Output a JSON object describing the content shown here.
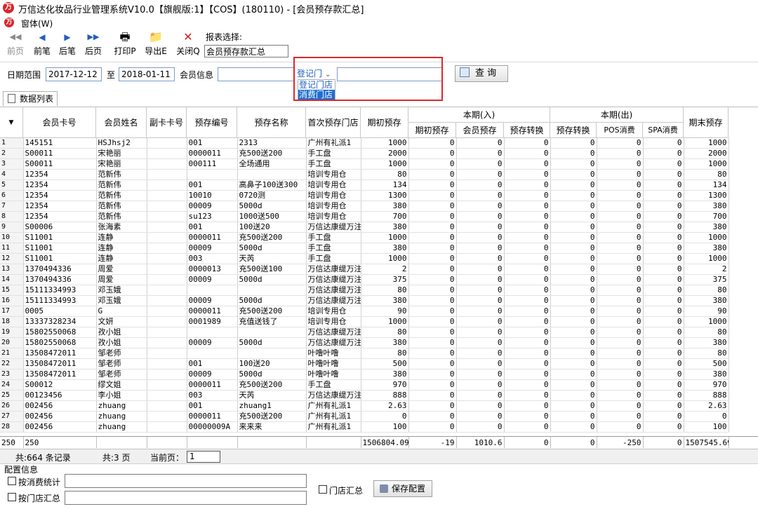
{
  "window": {
    "title": "万信达化妆品行业管理系统V10.0【旗舰版:1】【COS】(180110) - [会员预存款汇总]",
    "logo_text": "万"
  },
  "menu": {
    "item": "窗体(W)"
  },
  "toolbar": {
    "buttons": [
      {
        "label": "前页",
        "icon": "◀◀",
        "disabled": true
      },
      {
        "label": "前笔",
        "icon": "◀",
        "disabled": false
      },
      {
        "label": "后笔",
        "icon": "▶",
        "disabled": false
      },
      {
        "label": "后页",
        "icon": "▶▶",
        "disabled": false
      },
      {
        "label": "打印P",
        "icon": "🖶",
        "disabled": false
      },
      {
        "label": "导出E",
        "icon": "📁",
        "disabled": false
      },
      {
        "label": "关闭Q",
        "icon": "✕",
        "disabled": false
      }
    ],
    "report_label": "报表选择:",
    "report_value": "会员预存款汇总"
  },
  "filter": {
    "date_label": "日期范围",
    "date_from": "2017-12-12",
    "to_label": "至",
    "date_to": "2018-01-11",
    "member_label": "会员信息",
    "member_value": "",
    "store_combo": "登记门",
    "store_value": "",
    "dropdown_options": [
      "登记门店",
      "消费门店"
    ],
    "query_label": "查 询"
  },
  "tab": {
    "label": "数据列表"
  },
  "columns": {
    "card": "会员卡号",
    "name": "会员姓名",
    "subcard": "副卡卡号",
    "preno": "预存编号",
    "prename": "预存名称",
    "firststore": "首次预存门店",
    "initial": "期初预存",
    "in_group": "本期(入)",
    "in_initial": "期初预存",
    "in_member": "会员预存",
    "in_transfer": "预存转换",
    "out_group": "本期(出)",
    "out_transfer": "预存转换",
    "out_pos": "POS消费",
    "out_spa": "SPA消费",
    "ending": "期末预存"
  },
  "rows": [
    [
      "1",
      "145151",
      "HSJhsj2",
      "",
      "001",
      "2313",
      "广州有礼派1",
      "1000",
      "0",
      "0",
      "0",
      "0",
      "0",
      "0",
      "1000"
    ],
    [
      "2",
      "S00011",
      "宋艳丽",
      "",
      "0000011",
      "充500送200",
      "手工盘",
      "2000",
      "0",
      "0",
      "0",
      "0",
      "0",
      "0",
      "2000"
    ],
    [
      "3",
      "S00011",
      "宋艳丽",
      "",
      "000111",
      "全场通用",
      "手工盘",
      "1000",
      "0",
      "0",
      "0",
      "0",
      "0",
      "0",
      "1000"
    ],
    [
      "4",
      "12354",
      "范新伟",
      "",
      "",
      "",
      "培训专用仓",
      "80",
      "0",
      "0",
      "0",
      "0",
      "0",
      "0",
      "80"
    ],
    [
      "5",
      "12354",
      "范新伟",
      "",
      "001",
      "高鼻子100送300",
      "培训专用仓",
      "134",
      "0",
      "0",
      "0",
      "0",
      "0",
      "0",
      "134"
    ],
    [
      "6",
      "12354",
      "范新伟",
      "",
      "10010",
      "0720测",
      "培训专用仓",
      "1300",
      "0",
      "0",
      "0",
      "0",
      "0",
      "0",
      "1300"
    ],
    [
      "7",
      "12354",
      "范新伟",
      "",
      "00009",
      "5000d",
      "培训专用仓",
      "380",
      "0",
      "0",
      "0",
      "0",
      "0",
      "0",
      "380"
    ],
    [
      "8",
      "12354",
      "范新伟",
      "",
      "su123",
      "1000送500",
      "培训专用仓",
      "700",
      "0",
      "0",
      "0",
      "0",
      "0",
      "0",
      "700"
    ],
    [
      "9",
      "S00006",
      "张海素",
      "",
      "001",
      "100送20",
      "万信达康缇万注",
      "380",
      "0",
      "0",
      "0",
      "0",
      "0",
      "0",
      "380"
    ],
    [
      "10",
      "S11001",
      "连静",
      "",
      "0000011",
      "充500送200",
      "手工盘",
      "1000",
      "0",
      "0",
      "0",
      "0",
      "0",
      "0",
      "1000"
    ],
    [
      "11",
      "S11001",
      "连静",
      "",
      "00009",
      "5000d",
      "手工盘",
      "380",
      "0",
      "0",
      "0",
      "0",
      "0",
      "0",
      "380"
    ],
    [
      "12",
      "S11001",
      "连静",
      "",
      "003",
      "天芮",
      "手工盘",
      "1000",
      "0",
      "0",
      "0",
      "0",
      "0",
      "0",
      "1000"
    ],
    [
      "13",
      "1370494336",
      "周爱",
      "",
      "0000013",
      "充500送100",
      "万信达康缇万注",
      "2",
      "0",
      "0",
      "0",
      "0",
      "0",
      "0",
      "2"
    ],
    [
      "14",
      "1370494336",
      "周爱",
      "",
      "00009",
      "5000d",
      "万信达康缇万注",
      "375",
      "0",
      "0",
      "0",
      "0",
      "0",
      "0",
      "375"
    ],
    [
      "15",
      "15111334993",
      "邓玉娥",
      "",
      "",
      "",
      "万信达康缇万注",
      "80",
      "0",
      "0",
      "0",
      "0",
      "0",
      "0",
      "80"
    ],
    [
      "16",
      "15111334993",
      "邓玉娥",
      "",
      "00009",
      "5000d",
      "万信达康缇万注",
      "380",
      "0",
      "0",
      "0",
      "0",
      "0",
      "0",
      "380"
    ],
    [
      "17",
      "0005",
      "G",
      "",
      "0000011",
      "充500送200",
      "培训专用仓",
      "90",
      "0",
      "0",
      "0",
      "0",
      "0",
      "0",
      "90"
    ],
    [
      "18",
      "13337328234",
      "文妍",
      "",
      "0001989",
      "充值送钱了",
      "培训专用仓",
      "1000",
      "0",
      "0",
      "0",
      "0",
      "0",
      "0",
      "1000"
    ],
    [
      "19",
      "15802550068",
      "孜小姐",
      "",
      "",
      "",
      "万信达康缇万注",
      "80",
      "0",
      "0",
      "0",
      "0",
      "0",
      "0",
      "80"
    ],
    [
      "20",
      "15802550068",
      "孜小姐",
      "",
      "00009",
      "5000d",
      "万信达康缇万注",
      "380",
      "0",
      "0",
      "0",
      "0",
      "0",
      "0",
      "380"
    ],
    [
      "21",
      "13508472011",
      "邹老师",
      "",
      "",
      "",
      "叶噜叶噜",
      "80",
      "0",
      "0",
      "0",
      "0",
      "0",
      "0",
      "80"
    ],
    [
      "22",
      "13508472011",
      "邹老师",
      "",
      "001",
      "100送20",
      "叶噜叶噜",
      "500",
      "0",
      "0",
      "0",
      "0",
      "0",
      "0",
      "500"
    ],
    [
      "23",
      "13508472011",
      "邹老师",
      "",
      "00009",
      "5000d",
      "叶噜叶噜",
      "380",
      "0",
      "0",
      "0",
      "0",
      "0",
      "0",
      "380"
    ],
    [
      "24",
      "S00012",
      "缪文姐",
      "",
      "0000011",
      "充500送200",
      "手工盘",
      "970",
      "0",
      "0",
      "0",
      "0",
      "0",
      "0",
      "970"
    ],
    [
      "25",
      "00123456",
      "李小姐",
      "",
      "003",
      "天芮",
      "万信达康缇万注",
      "888",
      "0",
      "0",
      "0",
      "0",
      "0",
      "0",
      "888"
    ],
    [
      "26",
      "002456",
      "zhuang",
      "",
      "001",
      "zhuang1",
      "广州有礼派1",
      "2.63",
      "0",
      "0",
      "0",
      "0",
      "0",
      "0",
      "2.63"
    ],
    [
      "27",
      "002456",
      "zhuang",
      "",
      "0000011",
      "充500送200",
      "广州有礼派1",
      "0",
      "0",
      "0",
      "0",
      "0",
      "0",
      "0",
      "0"
    ],
    [
      "28",
      "002456",
      "zhuang",
      "",
      "00000009A",
      "来来来",
      "广州有礼派1",
      "100",
      "0",
      "0",
      "0",
      "0",
      "0",
      "0",
      "100"
    ]
  ],
  "totals": {
    "rownum": "250",
    "card": "250",
    "initial": "1506804.09",
    "in_initial": "-19",
    "in_member": "1010.6",
    "in_transfer": "0",
    "out_transfer": "0",
    "out_pos": "-250",
    "out_spa": "0",
    "ending": "1507545.69"
  },
  "status": {
    "records": "共:664 条记录",
    "pages": "共:3 页",
    "current_label": "当前页：",
    "current_value": "1"
  },
  "config": {
    "title": "配置信息",
    "by_consume_label": "按消费统计",
    "by_store_label": "按门店汇总",
    "store_summary_label": "门店汇总",
    "save_label": "保存配置"
  }
}
